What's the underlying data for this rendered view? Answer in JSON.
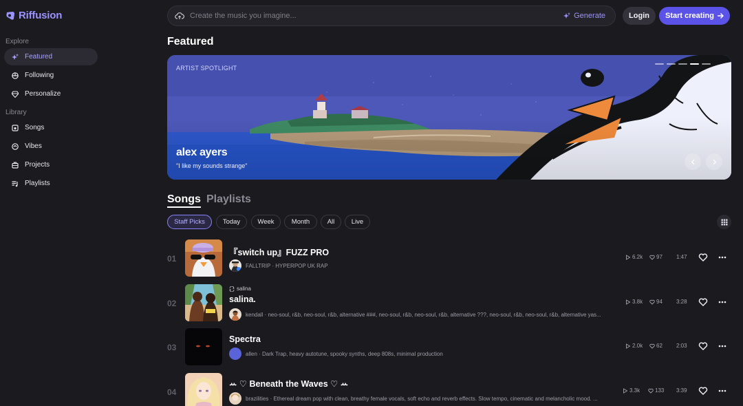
{
  "brand": {
    "name": "Riffusion",
    "accent": "#9b93ff",
    "primary_button": "#5b52e8"
  },
  "sidebar": {
    "explore_label": "Explore",
    "library_label": "Library",
    "explore_items": [
      {
        "label": "Featured",
        "icon": "sparkle-icon",
        "active": true
      },
      {
        "label": "Following",
        "icon": "following-icon"
      },
      {
        "label": "Personalize",
        "icon": "gem-icon"
      }
    ],
    "library_items": [
      {
        "label": "Songs",
        "icon": "songs-icon"
      },
      {
        "label": "Vibes",
        "icon": "vibes-icon"
      },
      {
        "label": "Projects",
        "icon": "projects-icon"
      },
      {
        "label": "Playlists",
        "icon": "playlists-icon"
      }
    ]
  },
  "topbar": {
    "search_placeholder": "Create the music you imagine...",
    "generate_label": "Generate",
    "login_label": "Login",
    "start_label": "Start creating"
  },
  "featured": {
    "heading": "Featured",
    "spotlight_label": "ARTIST SPOTLIGHT",
    "artist_name": "alex ayers",
    "quote": "\"I like my sounds strange\"",
    "slide_count": 5,
    "active_slide": 4
  },
  "tabs": {
    "songs": "Songs",
    "playlists": "Playlists",
    "active": "Songs"
  },
  "filters": [
    "Staff Picks",
    "Today",
    "Week",
    "Month",
    "All",
    "Live"
  ],
  "active_filter": "Staff Picks",
  "songs": [
    {
      "num": "01",
      "title": "『switch up』FUZZ PRO",
      "remix_of": "",
      "artist_desc": "FALLTRIP · HYPERPOP UK RAP",
      "plays": "6.2k",
      "likes": "97",
      "duration": "1:47"
    },
    {
      "num": "02",
      "title": "salina.",
      "remix_of": "salina",
      "artist_desc": "kendall · neo-soul, r&b, neo-soul, r&b, alternative ###, neo-soul, r&b, neo-soul, r&b, alternative ???, neo-soul, r&b, neo-soul, r&b, alternative yas...",
      "plays": "3.8k",
      "likes": "94",
      "duration": "3:28"
    },
    {
      "num": "03",
      "title": "Spectra",
      "remix_of": "",
      "artist_desc": "allen · Dark Trap, heavy autotune, spooky synths, deep 808s, minimal production",
      "plays": "2.0k",
      "likes": "62",
      "duration": "2:03"
    },
    {
      "num": "04",
      "title": "ꕀ ♡ Beneath the Waves ♡ ꕀ",
      "remix_of": "",
      "artist_desc": "brazilities · Ethereal dream pop with clean, breathy female vocals, soft echo and reverb effects. Slow tempo, cinematic and melancholic mood. ...",
      "plays": "3.3k",
      "likes": "133",
      "duration": "3:39"
    }
  ]
}
